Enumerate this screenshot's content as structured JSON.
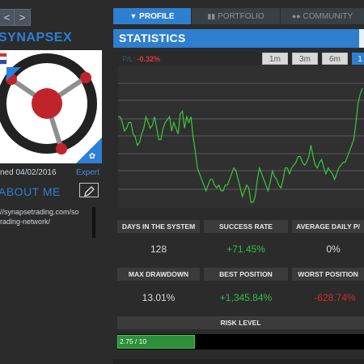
{
  "nav": {
    "back_glyph": "<",
    "forward_glyph": ">"
  },
  "profile": {
    "username": "SYNAPSEX",
    "joined": "ned 04/02/2016",
    "badge": "Expert",
    "about_title": "ABOUT ME",
    "bio_lines": [
      "//synapsetrading.com/so",
      "rading-network/"
    ]
  },
  "tabs": [
    {
      "label": "PROFILE",
      "icon": "tie-icon",
      "active": true
    },
    {
      "label": "PORTFOLIO",
      "icon": "bar-chart-icon",
      "active": false
    },
    {
      "label": "COMMUNITY",
      "icon": "users-icon",
      "active": false
    }
  ],
  "statistics": {
    "title": "STATISTICS",
    "pnl_label": "P/L:",
    "pnl_value": "-0.32%",
    "ranges": [
      {
        "label": "1m",
        "selected": false
      },
      {
        "label": "3m",
        "selected": false
      },
      {
        "label": "6m",
        "selected": false
      },
      {
        "label": "1",
        "selected": true
      }
    ]
  },
  "stats_row1": [
    {
      "label": "DAYS IN THE SYSTEM",
      "value": "128",
      "tone": "neutral"
    },
    {
      "label": "SUCCESS RATE",
      "value": "+71.45%",
      "tone": "pos"
    },
    {
      "label": "AVERAGE DAILY P/",
      "value": "0%",
      "tone": "neutral"
    }
  ],
  "stats_row2": [
    {
      "label": "MAX DRAWDOWN",
      "value": "13.01%",
      "tone": "neutral"
    },
    {
      "label": "BEST POSITION",
      "value": "+1,345.84%",
      "tone": "pos"
    },
    {
      "label": "WORST POSITION",
      "value": "-628.74%",
      "tone": "neg"
    }
  ],
  "risk": {
    "label": "RISK LEVEL",
    "value_text": "2.75 / 10",
    "value": 2.75,
    "max": 10
  },
  "colors": {
    "accent": "#2e7fd0",
    "positive": "#2fbf4a",
    "negative": "#d8292b",
    "line": "#39c939"
  },
  "chart_data": {
    "type": "line",
    "series": [
      {
        "values": [
          62,
          62,
          60,
          57,
          58,
          60,
          60,
          56,
          55,
          52,
          53,
          56,
          58,
          62,
          60,
          58,
          59,
          62,
          58,
          54,
          54,
          58,
          60,
          61,
          62,
          57,
          60,
          58,
          56,
          63,
          64,
          58,
          62,
          60,
          62,
          55,
          50,
          44,
          42,
          40,
          38,
          36,
          38,
          40,
          40,
          38,
          37,
          38,
          36,
          36,
          38,
          38,
          40,
          42,
          44,
          43,
          40,
          37,
          34,
          36,
          38,
          37,
          32,
          32,
          34,
          40,
          44,
          42,
          40,
          38,
          36,
          39,
          43,
          41,
          40,
          38,
          37,
          40,
          44,
          44,
          42,
          44,
          45,
          46,
          48,
          48,
          46,
          45,
          46,
          48,
          52,
          48,
          45,
          44,
          46,
          47,
          44,
          42,
          44,
          43,
          42,
          40,
          42,
          44,
          45,
          46,
          46,
          48,
          50,
          52,
          54,
          60,
          67,
          70,
          72
        ]
      }
    ],
    "ylim": [
      30,
      80
    ],
    "grid": true
  }
}
